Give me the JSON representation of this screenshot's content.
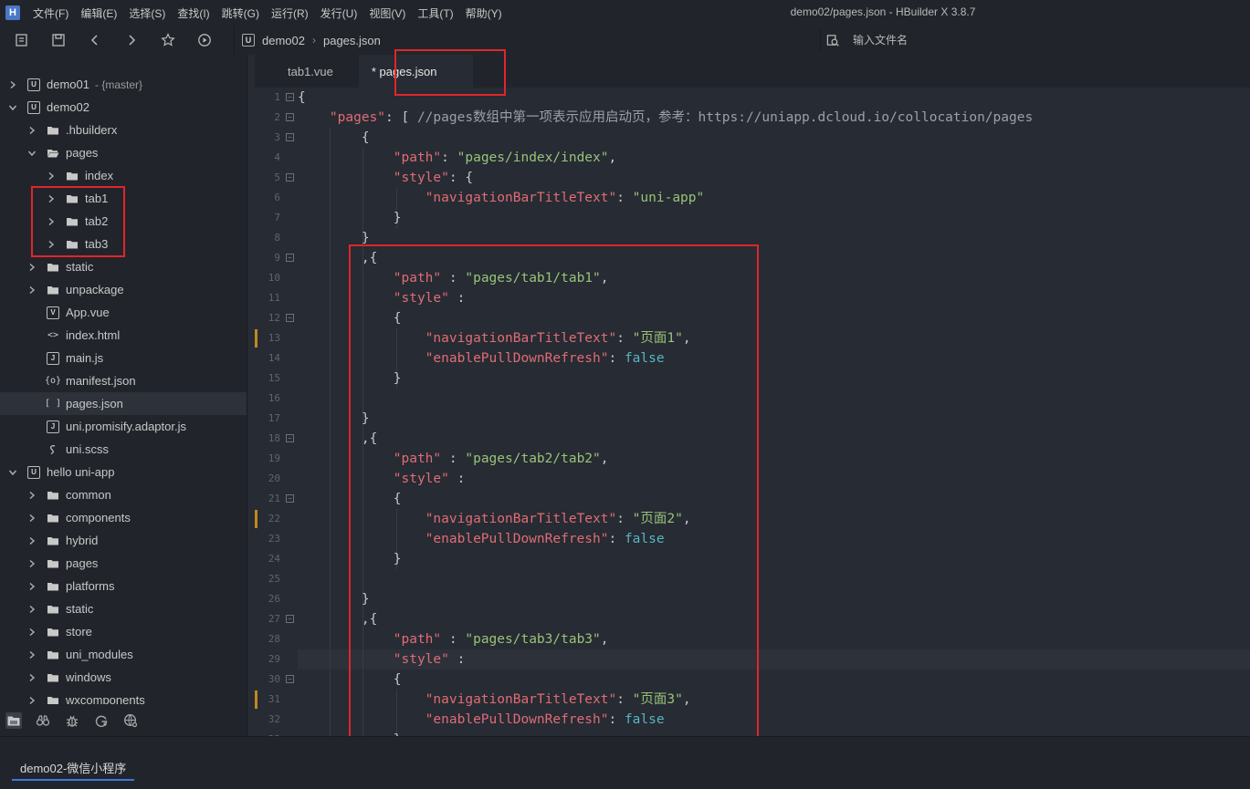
{
  "menu": [
    "文件(F)",
    "编辑(E)",
    "选择(S)",
    "查找(I)",
    "跳转(G)",
    "运行(R)",
    "发行(U)",
    "视图(V)",
    "工具(T)",
    "帮助(Y)"
  ],
  "window_title": "demo02/pages.json - HBuilder X 3.8.7",
  "app_logo": "H",
  "toolbar": {
    "breadcrumb": [
      "demo02",
      "pages.json"
    ],
    "search_placeholder": "输入文件名"
  },
  "tree": [
    {
      "label": "demo01",
      "suffix": "- {master}",
      "arrow": "right",
      "icon": "U"
    },
    {
      "label": "demo02",
      "arrow": "down",
      "icon": "U"
    },
    {
      "label": ".hbuilderx",
      "arrow": "right",
      "icon": "folder"
    },
    {
      "label": "pages",
      "arrow": "down",
      "icon": "folder-open"
    },
    {
      "label": "index",
      "arrow": "right",
      "icon": "folder"
    },
    {
      "label": "tab1",
      "arrow": "right",
      "icon": "folder"
    },
    {
      "label": "tab2",
      "arrow": "right",
      "icon": "folder"
    },
    {
      "label": "tab3",
      "arrow": "right",
      "icon": "folder"
    },
    {
      "label": "static",
      "arrow": "right",
      "icon": "folder"
    },
    {
      "label": "unpackage",
      "arrow": "right",
      "icon": "folder"
    },
    {
      "label": "App.vue",
      "icon": "V"
    },
    {
      "label": "index.html",
      "icon": "<>"
    },
    {
      "label": "main.js",
      "icon": "J"
    },
    {
      "label": "manifest.json",
      "icon": "{o}"
    },
    {
      "label": "pages.json",
      "icon": "[ ]"
    },
    {
      "label": "uni.promisify.adaptor.js",
      "icon": "J"
    },
    {
      "label": "uni.scss",
      "icon": "S"
    },
    {
      "label": "hello uni-app",
      "arrow": "down",
      "icon": "U"
    },
    {
      "label": "common",
      "arrow": "right",
      "icon": "folder"
    },
    {
      "label": "components",
      "arrow": "right",
      "icon": "folder"
    },
    {
      "label": "hybrid",
      "arrow": "right",
      "icon": "folder"
    },
    {
      "label": "pages",
      "arrow": "right",
      "icon": "folder"
    },
    {
      "label": "platforms",
      "arrow": "right",
      "icon": "folder"
    },
    {
      "label": "static",
      "arrow": "right",
      "icon": "folder"
    },
    {
      "label": "store",
      "arrow": "right",
      "icon": "folder"
    },
    {
      "label": "uni_modules",
      "arrow": "right",
      "icon": "folder"
    },
    {
      "label": "windows",
      "arrow": "right",
      "icon": "folder"
    },
    {
      "label": "wxcomponents",
      "arrow": "right",
      "icon": "folder"
    }
  ],
  "sidebar_bottom_icons": [
    "file-tree-icon",
    "binoculars-icon",
    "bug-icon",
    "git-icon",
    "plugin-icon"
  ],
  "tabs": [
    {
      "label": "tab1.vue",
      "active": false
    },
    {
      "label": "* pages.json",
      "active": true
    }
  ],
  "editor": {
    "changed_lines": [
      13,
      22,
      31
    ],
    "current_line": 29,
    "lines": [
      {
        "n": 1,
        "fold": true,
        "tokens": [
          [
            "p",
            "{"
          ]
        ]
      },
      {
        "n": 2,
        "fold": true,
        "tokens": [
          [
            "p",
            "    "
          ],
          [
            "k",
            "\"pages\""
          ],
          [
            "p",
            ": [ "
          ],
          [
            "c",
            "//pages数组中第一项表示应用启动页，参考：https://uniapp.dcloud.io/collocation/pages"
          ]
        ]
      },
      {
        "n": 3,
        "fold": true,
        "tokens": [
          [
            "p",
            "        {"
          ]
        ]
      },
      {
        "n": 4,
        "fold": false,
        "tokens": [
          [
            "p",
            "            "
          ],
          [
            "k",
            "\"path\""
          ],
          [
            "p",
            ": "
          ],
          [
            "s",
            "\"pages/index/index\""
          ],
          [
            "p",
            ","
          ]
        ]
      },
      {
        "n": 5,
        "fold": true,
        "tokens": [
          [
            "p",
            "            "
          ],
          [
            "k",
            "\"style\""
          ],
          [
            "p",
            ": {"
          ]
        ]
      },
      {
        "n": 6,
        "fold": false,
        "tokens": [
          [
            "p",
            "                "
          ],
          [
            "k",
            "\"navigationBarTitleText\""
          ],
          [
            "p",
            ": "
          ],
          [
            "s",
            "\"uni-app\""
          ]
        ]
      },
      {
        "n": 7,
        "fold": false,
        "tokens": [
          [
            "p",
            "            }"
          ]
        ]
      },
      {
        "n": 8,
        "fold": false,
        "tokens": [
          [
            "p",
            "        }"
          ]
        ]
      },
      {
        "n": 9,
        "fold": true,
        "tokens": [
          [
            "p",
            "        ,{"
          ]
        ]
      },
      {
        "n": 10,
        "fold": false,
        "tokens": [
          [
            "p",
            "            "
          ],
          [
            "k",
            "\"path\""
          ],
          [
            "p",
            " : "
          ],
          [
            "s",
            "\"pages/tab1/tab1\""
          ],
          [
            "p",
            ","
          ]
        ]
      },
      {
        "n": 11,
        "fold": false,
        "tokens": [
          [
            "p",
            "            "
          ],
          [
            "k",
            "\"style\""
          ],
          [
            "p",
            " :"
          ]
        ]
      },
      {
        "n": 12,
        "fold": true,
        "tokens": [
          [
            "p",
            "            {"
          ]
        ]
      },
      {
        "n": 13,
        "fold": false,
        "tokens": [
          [
            "p",
            "                "
          ],
          [
            "k",
            "\"navigationBarTitleText\""
          ],
          [
            "p",
            ": "
          ],
          [
            "s",
            "\"页面1\""
          ],
          [
            "p",
            ","
          ]
        ]
      },
      {
        "n": 14,
        "fold": false,
        "tokens": [
          [
            "p",
            "                "
          ],
          [
            "k",
            "\"enablePullDownRefresh\""
          ],
          [
            "p",
            ": "
          ],
          [
            "b",
            "false"
          ]
        ]
      },
      {
        "n": 15,
        "fold": false,
        "tokens": [
          [
            "p",
            "            }"
          ]
        ]
      },
      {
        "n": 16,
        "fold": false,
        "tokens": [
          [
            "p",
            ""
          ]
        ]
      },
      {
        "n": 17,
        "fold": false,
        "tokens": [
          [
            "p",
            "        }"
          ]
        ]
      },
      {
        "n": 18,
        "fold": true,
        "tokens": [
          [
            "p",
            "        ,{"
          ]
        ]
      },
      {
        "n": 19,
        "fold": false,
        "tokens": [
          [
            "p",
            "            "
          ],
          [
            "k",
            "\"path\""
          ],
          [
            "p",
            " : "
          ],
          [
            "s",
            "\"pages/tab2/tab2\""
          ],
          [
            "p",
            ","
          ]
        ]
      },
      {
        "n": 20,
        "fold": false,
        "tokens": [
          [
            "p",
            "            "
          ],
          [
            "k",
            "\"style\""
          ],
          [
            "p",
            " :"
          ]
        ]
      },
      {
        "n": 21,
        "fold": true,
        "tokens": [
          [
            "p",
            "            {"
          ]
        ]
      },
      {
        "n": 22,
        "fold": false,
        "tokens": [
          [
            "p",
            "                "
          ],
          [
            "k",
            "\"navigationBarTitleText\""
          ],
          [
            "p",
            ": "
          ],
          [
            "s",
            "\"页面2\""
          ],
          [
            "p",
            ","
          ]
        ]
      },
      {
        "n": 23,
        "fold": false,
        "tokens": [
          [
            "p",
            "                "
          ],
          [
            "k",
            "\"enablePullDownRefresh\""
          ],
          [
            "p",
            ": "
          ],
          [
            "b",
            "false"
          ]
        ]
      },
      {
        "n": 24,
        "fold": false,
        "tokens": [
          [
            "p",
            "            }"
          ]
        ]
      },
      {
        "n": 25,
        "fold": false,
        "tokens": [
          [
            "p",
            ""
          ]
        ]
      },
      {
        "n": 26,
        "fold": false,
        "tokens": [
          [
            "p",
            "        }"
          ]
        ]
      },
      {
        "n": 27,
        "fold": true,
        "tokens": [
          [
            "p",
            "        ,{"
          ]
        ]
      },
      {
        "n": 28,
        "fold": false,
        "tokens": [
          [
            "p",
            "            "
          ],
          [
            "k",
            "\"path\""
          ],
          [
            "p",
            " : "
          ],
          [
            "s",
            "\"pages/tab3/tab3\""
          ],
          [
            "p",
            ","
          ]
        ]
      },
      {
        "n": 29,
        "fold": false,
        "tokens": [
          [
            "p",
            "            "
          ],
          [
            "k",
            "\"style\""
          ],
          [
            "p",
            " :"
          ]
        ]
      },
      {
        "n": 30,
        "fold": true,
        "tokens": [
          [
            "p",
            "            {"
          ]
        ]
      },
      {
        "n": 31,
        "fold": false,
        "tokens": [
          [
            "p",
            "                "
          ],
          [
            "k",
            "\"navigationBarTitleText\""
          ],
          [
            "p",
            ": "
          ],
          [
            "s",
            "\"页面3\""
          ],
          [
            "p",
            ","
          ]
        ]
      },
      {
        "n": 32,
        "fold": false,
        "tokens": [
          [
            "p",
            "                "
          ],
          [
            "k",
            "\"enablePullDownRefresh\""
          ],
          [
            "p",
            ": "
          ],
          [
            "b",
            "false"
          ]
        ]
      },
      {
        "n": 33,
        "fold": false,
        "tokens": [
          [
            "p",
            "            }"
          ]
        ]
      }
    ]
  },
  "console_tab": "demo02-微信小程序",
  "colors": {
    "bg": "#272b33",
    "sidebar": "#21252b",
    "key": "#e06c75",
    "string": "#98c379",
    "boolean": "#56b6c2",
    "comment": "#9aa0aa",
    "annotation": "#e0262a",
    "accent": "#3d78d8"
  }
}
